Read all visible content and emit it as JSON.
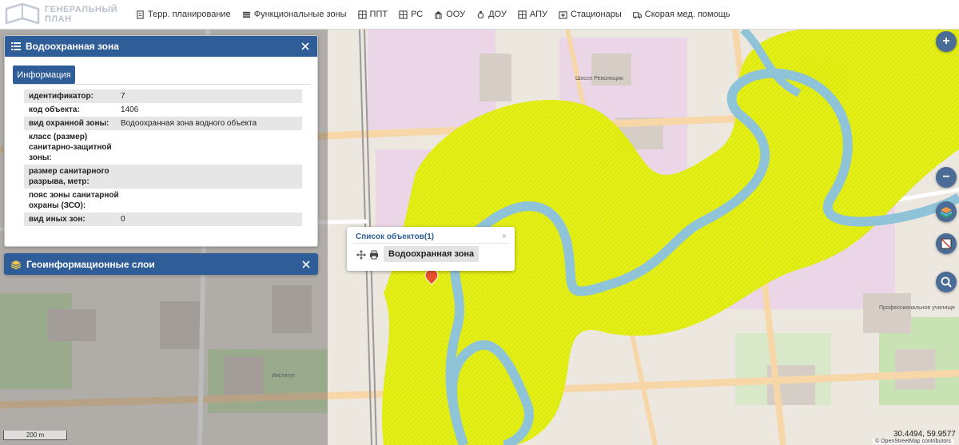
{
  "header": {
    "logo": "ГЕНЕРАЛЬНЫЙ ПЛАН",
    "nav": [
      {
        "label": "Терр. планирование",
        "icon": "document-icon"
      },
      {
        "label": "Функциональные зоны",
        "icon": "list-icon"
      },
      {
        "label": "ППТ",
        "icon": "grid-icon"
      },
      {
        "label": "РС",
        "icon": "grid-icon"
      },
      {
        "label": "ООУ",
        "icon": "building-icon"
      },
      {
        "label": "ДОУ",
        "icon": "pacifier-icon"
      },
      {
        "label": "АПУ",
        "icon": "grid-icon"
      },
      {
        "label": "Стационары",
        "icon": "building-icon"
      },
      {
        "label": "Скорая мед. помощь",
        "icon": "ambulance-icon"
      }
    ]
  },
  "info_panel": {
    "title": "Водоохранная зона",
    "tab": "Информация",
    "attributes": [
      {
        "key": "идентификатор:",
        "value": "7"
      },
      {
        "key": "код объекта:",
        "value": "1406"
      },
      {
        "key": "вид охранной зоны:",
        "value": "Водоохранная зона водного объекта"
      },
      {
        "key": "класс (размер) санитарно-защитной зоны:",
        "value": ""
      },
      {
        "key": "размер санитарного разрыва, метр:",
        "value": ""
      },
      {
        "key": "пояс зоны санитарной охраны (ЗСО):",
        "value": ""
      },
      {
        "key": "вид иных зон:",
        "value": "0"
      }
    ]
  },
  "layers_panel": {
    "title": "Геоинформационные слои"
  },
  "popup": {
    "title": "Список объектов(1)",
    "close": "×",
    "item": "Водоохранная зона"
  },
  "controls": {
    "zoom_in": "+",
    "zoom_out": "−"
  },
  "scale": "200 m",
  "coords": "30.4494, 59.9577",
  "attribution": "© OpenStreetMap contributors",
  "map_labels": {
    "label_1": "Шоссе Революции",
    "label_2": "Институт",
    "label_3": "Профессиональное училище"
  },
  "colors": {
    "header_blue": "#2f5d98",
    "zone_yellow": "#e4f00a",
    "river": "#8fc3d8",
    "marker": "#e8502c"
  }
}
